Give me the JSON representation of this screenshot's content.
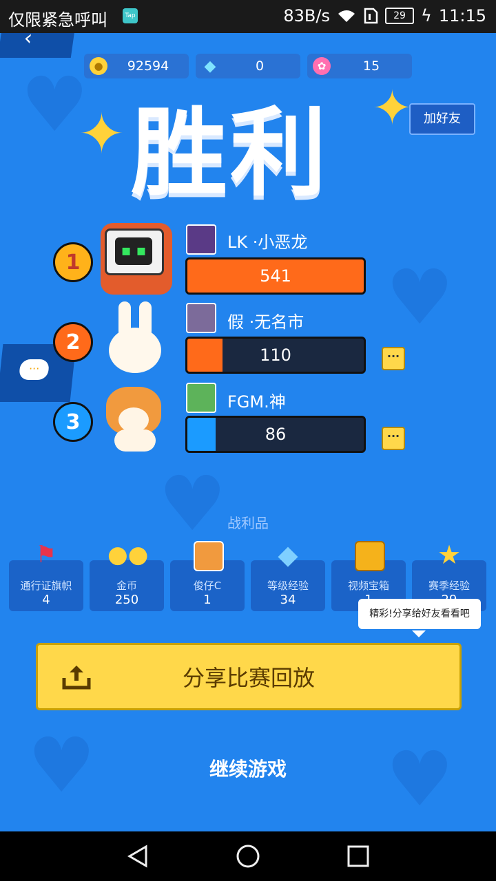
{
  "status_bar": {
    "carrier_text": "仅限紧急呼叫",
    "app_badge": "Tap",
    "network_speed": "83B/s",
    "battery_level": "29",
    "time": "11:15"
  },
  "currencies": [
    {
      "icon": "gold-coin-icon",
      "value": "92594",
      "color": "#ffd23a"
    },
    {
      "icon": "diamond-icon",
      "value": "0",
      "color": "#7fe3ff"
    },
    {
      "icon": "lotus-icon",
      "value": "15",
      "color": "#ff6fb0"
    }
  ],
  "title": "胜利",
  "add_friend_label": "加好友",
  "ranking": [
    {
      "rank": "1",
      "name": "LK ·小恶龙",
      "score": "541",
      "fill": 1.0,
      "bar_color": "#ff6a1a",
      "badge_color": "#ffb21a"
    },
    {
      "rank": "2",
      "name": "假 ·无名市",
      "score": "110",
      "fill": 0.2,
      "bar_color": "#ff6a1a",
      "badge_color": "#ff6a1a"
    },
    {
      "rank": "3",
      "name": "FGM.神",
      "score": "86",
      "fill": 0.16,
      "bar_color": "#1b9bff",
      "badge_color": "#1b9bff"
    }
  ],
  "more_label": "···",
  "loot_title": "战利品",
  "rewards": [
    {
      "label": "通行证旗帜",
      "count": "4",
      "icon": "flag-icon"
    },
    {
      "label": "金币",
      "count": "250",
      "icon": "coins-icon"
    },
    {
      "label": "俊仔C",
      "count": "1",
      "icon": "shiba-avatar-icon"
    },
    {
      "label": "等级经验",
      "count": "34",
      "icon": "crystal-icon"
    },
    {
      "label": "视频宝箱",
      "count": "1",
      "icon": "treasure-chest-icon"
    },
    {
      "label": "赛季经验",
      "count": "29",
      "icon": "star-icon"
    }
  ],
  "tooltip": "精彩!分享给好友看看吧",
  "share_label": "分享比赛回放",
  "continue_label": "继续游戏",
  "colors": {
    "background": "#2284ee",
    "share_button": "#ffd84a"
  }
}
